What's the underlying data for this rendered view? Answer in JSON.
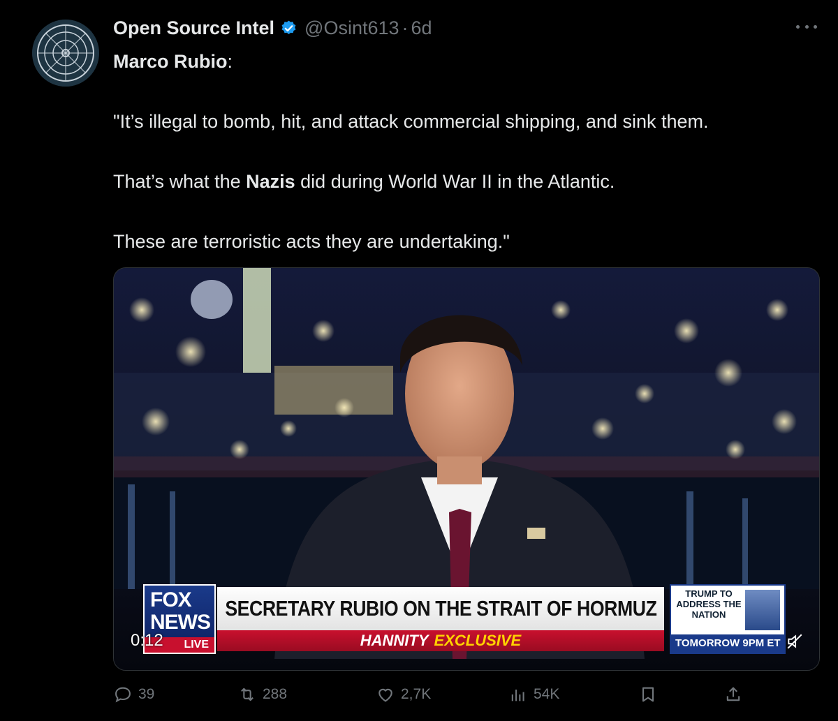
{
  "tweet": {
    "author_name": "Open Source Intel",
    "handle": "@Osint613",
    "separator": "·",
    "time": "6d",
    "text": {
      "line1_name": "Marco Rubio",
      "line1_colon": ":",
      "quote1": "\"It’s illegal to bomb, hit, and attack commercial shipping, and sink them.",
      "quote2_pre": "That’s what the ",
      "quote2_bold": "Nazis",
      "quote2_post": " did during World War II in the Atlantic.",
      "quote3": "These are terroristic acts they are undertaking.\""
    }
  },
  "video": {
    "timer": "0:12",
    "network_line1": "FOX",
    "network_line2": "NEWS",
    "network_live": "LIVE",
    "headline": "SECRETARY RUBIO ON THE STRAIT OF HORMUZ",
    "sub_white": "HANNITY",
    "sub_yellow": "EXCLUSIVE",
    "promo_text": "TRUMP TO ADDRESS THE NATION",
    "promo_bar": "TOMORROW 9PM ET"
  },
  "actions": {
    "replies": "39",
    "reposts": "288",
    "likes": "2,7K",
    "views": "54K"
  },
  "colors": {
    "background": "#000000",
    "text": "#e7e9ea",
    "muted": "#71767b",
    "verified": "#1d9bf0"
  },
  "icons": [
    "reply-icon",
    "repost-icon",
    "like-icon",
    "views-icon",
    "bookmark-icon",
    "share-icon",
    "verified-icon",
    "more-icon",
    "mute-icon"
  ]
}
